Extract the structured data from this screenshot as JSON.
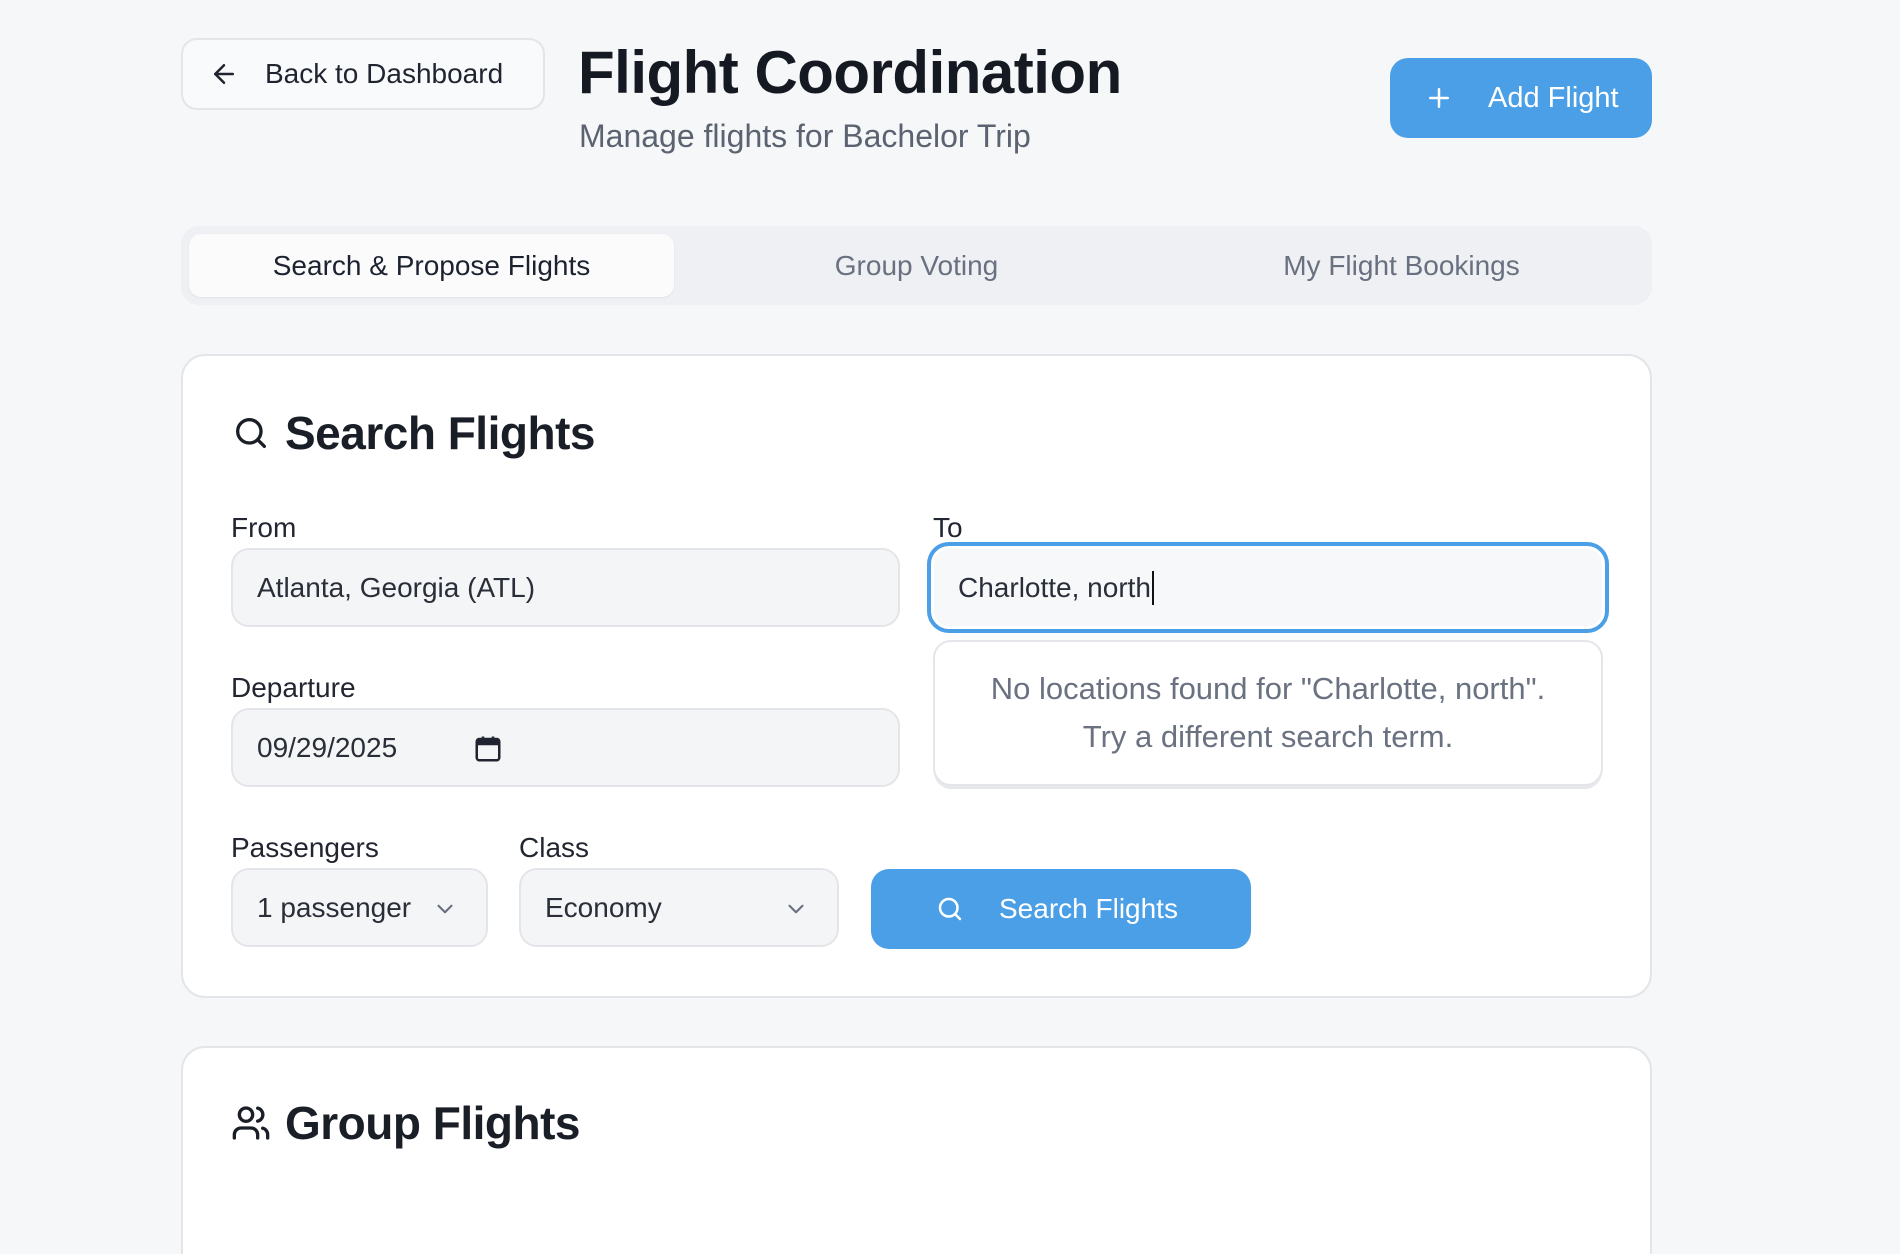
{
  "header": {
    "back_label": "Back to Dashboard",
    "title": "Flight Coordination",
    "subtitle": "Manage flights for Bachelor Trip",
    "add_label": "Add Flight"
  },
  "tabs": [
    {
      "label": "Search & Propose Flights",
      "active": true
    },
    {
      "label": "Group Voting",
      "active": false
    },
    {
      "label": "My Flight Bookings",
      "active": false
    }
  ],
  "search": {
    "title": "Search Flights",
    "from_label": "From",
    "from_value": "Atlanta, Georgia (ATL)",
    "to_label": "To",
    "to_value": "Charlotte, north",
    "departure_label": "Departure",
    "departure_value": "09/29/2025",
    "no_results_line1": "No locations found for \"Charlotte, north\".",
    "no_results_line2": "Try a different search term.",
    "passengers_label": "Passengers",
    "passengers_value": "1 passenger",
    "class_label": "Class",
    "class_value": "Economy",
    "search_button": "Search Flights"
  },
  "group": {
    "title": "Group Flights"
  },
  "colors": {
    "accent": "#4a9fe6",
    "background": "#f6f7f9"
  },
  "icons": [
    "arrow-left-icon",
    "plus-icon",
    "search-icon",
    "calendar-icon",
    "chevron-down-icon",
    "users-icon"
  ]
}
